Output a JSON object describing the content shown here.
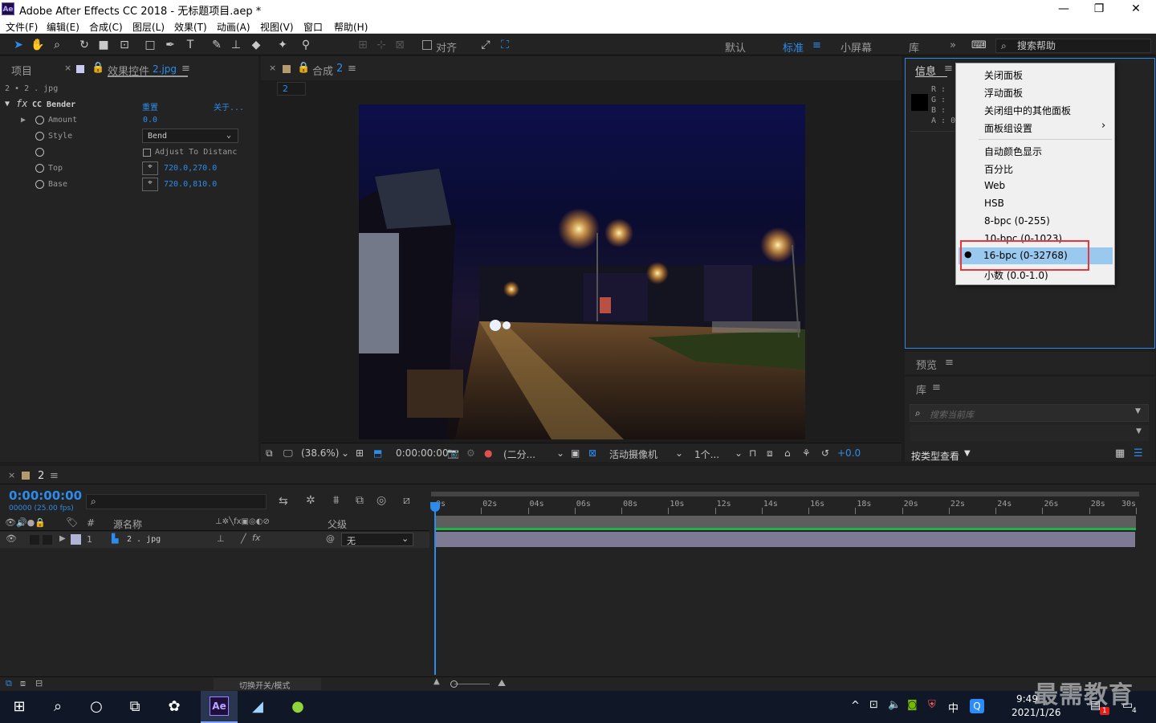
{
  "window": {
    "title": "Adobe After Effects CC 2018 - 无标题项目.aep *",
    "app_icon": "Ae"
  },
  "menu": [
    "文件(F)",
    "编辑(E)",
    "合成(C)",
    "图层(L)",
    "效果(T)",
    "动画(A)",
    "视图(V)",
    "窗口",
    "帮助(H)"
  ],
  "toolbar": {
    "align_label": "对齐",
    "workspaces": [
      "默认",
      "标准",
      "小屏幕",
      "库"
    ],
    "active_workspace": "标准",
    "search_help": "搜索帮助"
  },
  "project_panel": {
    "tab_project": "项目",
    "tab_effects": "效果控件",
    "tab_effects_file": "2.jpg",
    "layer_path": "2 • 2 . jpg",
    "effect_name": "CC Bender",
    "reset": "重置",
    "about": "关于...",
    "props": [
      {
        "name": "Amount",
        "value": "0.0"
      },
      {
        "name": "Style",
        "value": "Bend"
      },
      {
        "name": "",
        "value": "Adjust To Distanc"
      },
      {
        "name": "Top",
        "value": "720.0,270.0"
      },
      {
        "name": "Base",
        "value": "720.0,810.0"
      }
    ]
  },
  "comp_panel": {
    "tab_label": "合成",
    "tab_comp": "2",
    "sub_tab": "2",
    "zoom": "(38.6%)",
    "timecode": "0:00:00:00",
    "resolution": "(二分...",
    "camera": "活动摄像机",
    "views": "1个...",
    "exposure": "+0.0"
  },
  "info_panel": {
    "tab": "信息",
    "channels": [
      "R :",
      "G :",
      "B :",
      "A : 0"
    ]
  },
  "context_menu": {
    "items": [
      "关闭面板",
      "浮动面板",
      "关闭组中的其他面板",
      "面板组设置",
      "自动颜色显示",
      "百分比",
      "Web",
      "HSB",
      "8-bpc (0-255)",
      "10-bpc (0-1023)",
      "16-bpc (0-32768)",
      "小数 (0.0-1.0)"
    ],
    "selected": "16-bpc (0-32768)"
  },
  "preview_panel": {
    "tab": "预览"
  },
  "library_panel": {
    "tab": "库",
    "search_placeholder": "搜索当前库",
    "view_by": "按类型查看"
  },
  "timeline": {
    "tab": "2",
    "timecode": "0:00:00:00",
    "fps": "00000 (25.00 fps)",
    "col_num": "#",
    "col_source": "源名称",
    "col_parent": "父级",
    "ruler": [
      "0s",
      "02s",
      "04s",
      "06s",
      "08s",
      "10s",
      "12s",
      "14s",
      "16s",
      "18s",
      "20s",
      "22s",
      "24s",
      "26s",
      "28s",
      "30s"
    ],
    "layer": {
      "index": "1",
      "name": "2 . jpg",
      "parent": "无"
    },
    "toggle_modes": "切换开关/模式"
  },
  "taskbar": {
    "time": "9:49",
    "date": "2021/1/26",
    "ime": "中",
    "notification_badge": "1",
    "notification_count": "4"
  },
  "watermark": "最需教育",
  "colors": {
    "accent": "#2d8ceb",
    "highlight": "#99c9ef",
    "annotation": "#e8343c"
  }
}
